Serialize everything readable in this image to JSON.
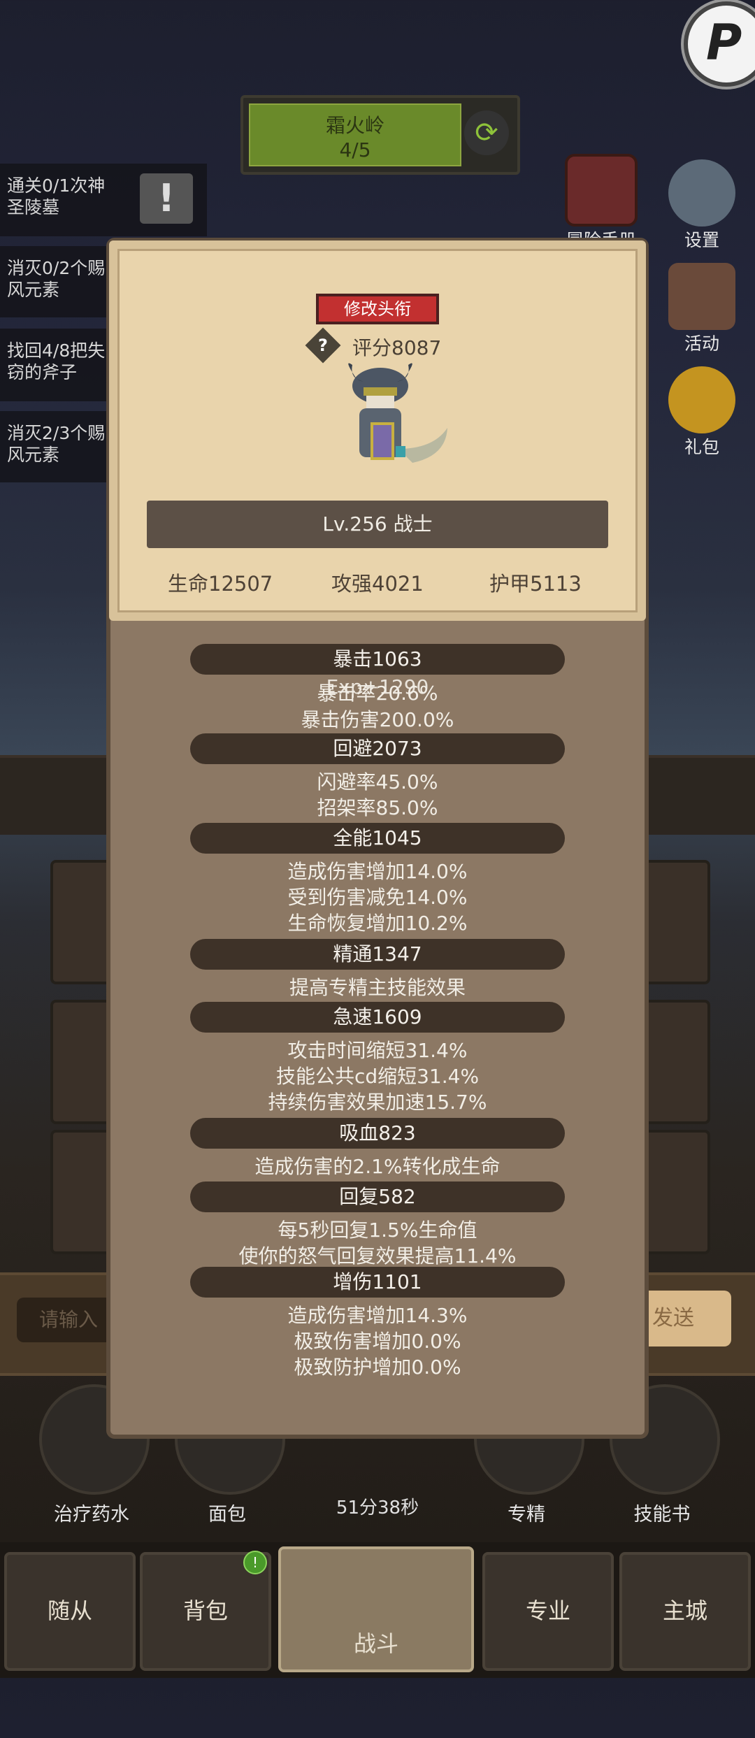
{
  "top": {
    "stage_name": "霜火岭",
    "stage_progress": "4/5"
  },
  "quests": [
    {
      "line1": "通关0/1次神",
      "line2": "圣陵墓"
    },
    {
      "line1": "消灭0/2个赐",
      "line2": "风元素"
    },
    {
      "line1": "找回4/8把失",
      "line2": "窃的斧子"
    },
    {
      "line1": "消灭2/3个赐",
      "line2": "风元素"
    }
  ],
  "side_buttons": {
    "adventure": "冒险手册",
    "settings": "设置",
    "activity": "活动",
    "gift": "礼包"
  },
  "chat": {
    "placeholder": "请输入",
    "send": "发送"
  },
  "items": {
    "potion": "治疗药水",
    "bread": "面包",
    "timer": "51分38秒",
    "mastery": "专精",
    "skillbook": "技能书"
  },
  "nav": {
    "followers": "随从",
    "bag": "背包",
    "battle": "战斗",
    "profession": "专业",
    "city": "主城",
    "badge": "!"
  },
  "card": {
    "change_title": "修改头衔",
    "help": "?",
    "score": "评分8087",
    "level_class": "Lv.256 战士",
    "hp": "生命12507",
    "attack": "攻强4021",
    "armor": "护甲5113"
  },
  "stats": {
    "crit_head": "暴击1063",
    "exp_overlay": "Exp+1290",
    "crit_rate": "暴击率20.6%",
    "crit_damage": "暴击伤害200.0%",
    "dodge_head": "回避2073",
    "dodge_rate": "闪避率45.0%",
    "parry_rate": "招架率85.0%",
    "versatility_head": "全能1045",
    "vers_dmg": "造成伤害增加14.0%",
    "vers_reduce": "受到伤害减免14.0%",
    "vers_regen": "生命恢复增加10.2%",
    "mastery_head": "精通1347",
    "mastery_desc": "提高专精主技能效果",
    "haste_head": "急速1609",
    "haste_attack": "攻击时间缩短31.4%",
    "haste_cd": "技能公共cd缩短31.4%",
    "haste_dot": "持续伤害效果加速15.7%",
    "leech_head": "吸血823",
    "leech_desc": "造成伤害的2.1%转化成生命",
    "regen_head": "回复582",
    "regen_hp": "每5秒回复1.5%生命值",
    "regen_rage": "使你的怒气回复效果提高11.4%",
    "dmgup_head": "增伤1101",
    "dmgup_dmg": "造成伤害增加14.3%",
    "dmgup_ultimate": "极致伤害增加0.0%",
    "dmgup_defense": "极致防护增加0.0%"
  }
}
